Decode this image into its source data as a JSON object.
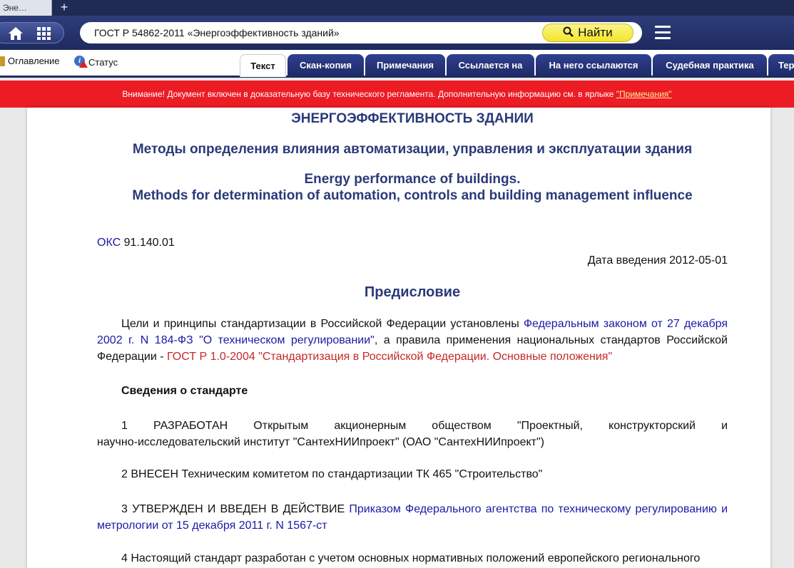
{
  "browser": {
    "tab_title": "Эне…",
    "new_tab": "+"
  },
  "toolbar": {
    "search_value": "ГОСТ Р 54862-2011 «Энергоэффективность зданий»",
    "find_label": "Найти",
    "icons": [
      "home-icon",
      "grid-icon",
      "search-icon",
      "menu-icon"
    ]
  },
  "subbar": {
    "toc_label": "Оглавление",
    "status_label": "Статус"
  },
  "doc_tabs": [
    {
      "label": "Текст",
      "active": true
    },
    {
      "label": "Скан-копия",
      "active": false
    },
    {
      "label": "Примечания",
      "active": false
    },
    {
      "label": "Ссылается на",
      "active": false
    },
    {
      "label": "На него ссылаются",
      "active": false
    },
    {
      "label": "Судебная практика",
      "active": false
    },
    {
      "label": "Тер",
      "active": false
    }
  ],
  "warning": {
    "text": "Внимание! Документ включен в доказательную базу технического регламента. Дополнительную информацию см. в ярлыке ",
    "link": "\"Примечания\""
  },
  "document": {
    "title": "ЭНЕРГОЭФФЕКТИВНОСТЬ ЗДАНИИ",
    "subtitle": "Методы определения влияния автоматизации, управления и эксплуатации здания",
    "title_en_1": "Energy performance of buildings.",
    "title_en_2": "Methods for determination of automation, controls and building management influence",
    "okc_label": "ОКС",
    "okc_value": " 91.140.01",
    "intro_date": "Дата введения 2012-05-01",
    "preface_heading": "Предисловие",
    "p1_text_a": "Цели и принципы стандартизации в Российской Федерации установлены ",
    "p1_link_a": "Федеральным законом от 27 декабря 2002 г. N 184-ФЗ \"О техническом регулировании\"",
    "p1_text_b": ", а правила применения национальных стандартов Российской Федерации - ",
    "p1_link_b": "ГОСТ Р 1.0-2004 \"Стандартизация в Российской Федерации. Основные положения\"",
    "info_heading": "Сведения о стандарте",
    "p2_line1": "1 РАЗРАБОТАН Открытым акционерным обществом \"Проектный, конструкторский и",
    "p2_line2": "научно-исследовательский институт \"СантехНИИпроект\" (ОАО \"СантехНИИпроект\")",
    "p3": "2 ВНЕСЕН Техническим комитетом по стандартизации ТК 465 \"Строительство\"",
    "p4_text": "3 УТВЕРЖДЕН И ВВЕДЕН В ДЕЙСТВИЕ ",
    "p4_link": "Приказом Федерального агентства по техническому регулированию и метрологии от 15 декабря 2011 г. N 1567-ст",
    "p5": "4 Настоящий стандарт разработан с учетом основных нормативных положений европейского регионального"
  }
}
